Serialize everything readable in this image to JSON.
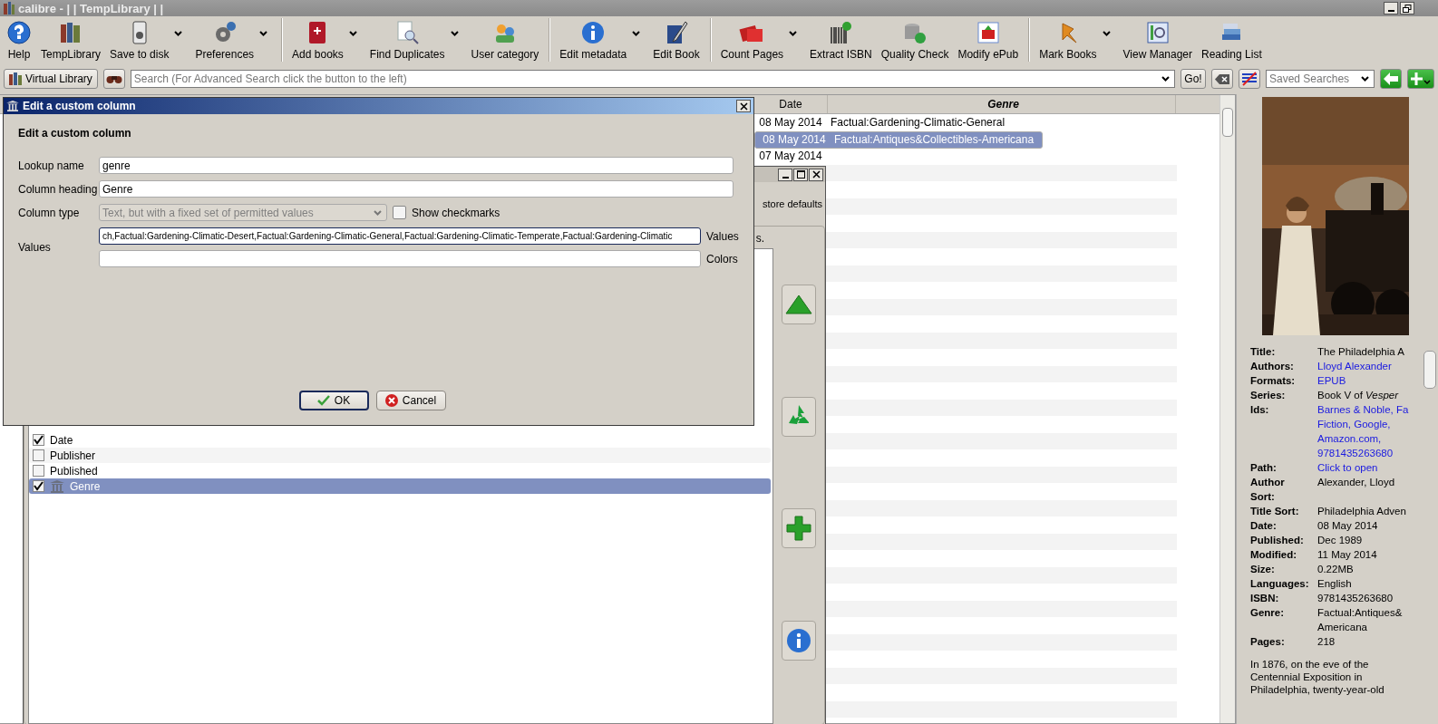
{
  "window": {
    "title": "calibre - | | TempLibrary | |"
  },
  "toolbar": [
    {
      "label": "Help",
      "dropdown": false,
      "separator_before": false
    },
    {
      "label": "TempLibrary",
      "dropdown": false,
      "separator_before": false
    },
    {
      "label": "Save to disk",
      "dropdown": true,
      "separator_before": false
    },
    {
      "label": "Preferences",
      "dropdown": true,
      "separator_before": false
    },
    {
      "label": "Add books",
      "dropdown": true,
      "separator_before": true
    },
    {
      "label": "Find Duplicates",
      "dropdown": true,
      "separator_before": false
    },
    {
      "label": "User category",
      "dropdown": false,
      "separator_before": false
    },
    {
      "label": "Edit metadata",
      "dropdown": true,
      "separator_before": true
    },
    {
      "label": "Edit Book",
      "dropdown": false,
      "separator_before": false
    },
    {
      "label": "Count Pages",
      "dropdown": true,
      "separator_before": true
    },
    {
      "label": "Extract ISBN",
      "dropdown": false,
      "separator_before": false
    },
    {
      "label": "Quality Check",
      "dropdown": false,
      "separator_before": false
    },
    {
      "label": "Modify ePub",
      "dropdown": false,
      "separator_before": false
    },
    {
      "label": "Mark Books",
      "dropdown": true,
      "separator_before": true
    },
    {
      "label": "View Manager",
      "dropdown": false,
      "separator_before": false
    },
    {
      "label": "Reading List",
      "dropdown": false,
      "separator_before": false
    }
  ],
  "search_bar": {
    "virtual_library": "Virtual Library",
    "placeholder": "Search (For Advanced Search click the button to the left)",
    "go": "Go!",
    "saved_searches_placeholder": "Saved Searches"
  },
  "book_table": {
    "columns": [
      {
        "label": "Date",
        "sorted": false
      },
      {
        "label": "Genre",
        "sorted": true
      }
    ],
    "rows": [
      {
        "date": "08 May 2014",
        "genre": "Factual:Gardening-Climatic-General",
        "selected": false
      },
      {
        "date": "08 May 2014",
        "genre": "Factual:Antiques&Collectibles-Americana",
        "selected": true
      },
      {
        "date": "07 May 2014",
        "selected": false
      }
    ]
  },
  "preferences_window": {
    "restore_defaults": "store defaults",
    "hint": "s.",
    "columns": [
      {
        "label": "Date",
        "checked": true,
        "selected": false,
        "custom": false
      },
      {
        "label": "Publisher",
        "checked": false,
        "selected": false,
        "custom": false
      },
      {
        "label": "Published",
        "checked": false,
        "selected": false,
        "custom": false
      },
      {
        "label": "Genre",
        "checked": true,
        "selected": true,
        "custom": true
      }
    ]
  },
  "custom_column_dialog": {
    "title": "Edit a custom column",
    "heading": "Edit a custom column",
    "lookup_name": {
      "label": "Lookup name",
      "value": "genre"
    },
    "column_heading": {
      "label": "Column heading",
      "value": "Genre"
    },
    "column_type": {
      "label": "Column type",
      "value": "Text, but with a fixed set of permitted values",
      "disabled": true
    },
    "show_checkmarks": {
      "label": "Show checkmarks",
      "checked": false
    },
    "values": {
      "label": "Values",
      "value": "ch,Factual:Gardening-Climatic-Desert,Factual:Gardening-Climatic-General,Factual:Gardening-Climatic-Temperate,Factual:Gardening-Climatic",
      "side_label": "Values"
    },
    "colors": {
      "side_label": "Colors"
    },
    "buttons": [
      {
        "label": "OK",
        "kind": "ok"
      },
      {
        "label": "Cancel",
        "kind": "cancel"
      }
    ]
  },
  "book_details": {
    "fields": [
      {
        "label": "Title:",
        "lines": [
          "The Philadelphia A"
        ],
        "link": false
      },
      {
        "label": "Authors:",
        "lines": [
          "Lloyd Alexander"
        ],
        "link": true
      },
      {
        "label": "Formats:",
        "lines": [
          "EPUB"
        ],
        "link": true
      },
      {
        "label": "Series:",
        "lines": [
          "Book V of *Vesper*"
        ],
        "link": false
      },
      {
        "label": "Ids:",
        "lines": [
          "Barnes & Noble, Fa",
          "Fiction, Google,",
          "Amazon.com,",
          "9781435263680"
        ],
        "link": true
      },
      {
        "label": "Path:",
        "lines": [
          "Click to open"
        ],
        "link": true
      },
      {
        "label": "Author\nSort:",
        "lines": [
          "Alexander, Lloyd"
        ],
        "link": false
      },
      {
        "label": "Title Sort:",
        "lines": [
          "Philadelphia Adven"
        ],
        "link": false
      },
      {
        "label": "Date:",
        "lines": [
          "08 May 2014"
        ],
        "link": false
      },
      {
        "label": "Published:",
        "lines": [
          "Dec 1989"
        ],
        "link": false
      },
      {
        "label": "Modified:",
        "lines": [
          "11 May 2014"
        ],
        "link": false
      },
      {
        "label": "Size:",
        "lines": [
          "0.22MB"
        ],
        "link": false
      },
      {
        "label": "Languages:",
        "lines": [
          "English"
        ],
        "link": false
      },
      {
        "label": "ISBN:",
        "lines": [
          "9781435263680"
        ],
        "link": false
      },
      {
        "label": "Genre:",
        "lines": [
          "Factual:Antiques&",
          "Americana"
        ],
        "link": false
      },
      {
        "label": "Pages:",
        "lines": [
          "218"
        ],
        "link": false
      }
    ],
    "description": "In 1876, on the eve of the Centennial Exposition in Philadelphia, twenty-year-old"
  }
}
